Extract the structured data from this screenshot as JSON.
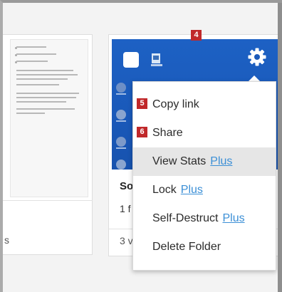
{
  "annotations": {
    "gear_badge": "4",
    "copy_link_badge": "5",
    "share_badge": "6"
  },
  "left_card": {
    "bottom_fragment": "s"
  },
  "right_card": {
    "title_fragment": "So",
    "subtitle_fragment": "1 f",
    "count_fragment": "3 v"
  },
  "menu": {
    "items": [
      {
        "label": "Copy link",
        "plus": ""
      },
      {
        "label": "Share",
        "plus": ""
      },
      {
        "label": "View Stats",
        "plus": "Plus"
      },
      {
        "label": "Lock",
        "plus": "Plus"
      },
      {
        "label": "Self-Destruct",
        "plus": "Plus"
      },
      {
        "label": "Delete Folder",
        "plus": ""
      }
    ],
    "hovered_index": 2
  },
  "colors": {
    "badge": "#c0282a",
    "plus_link": "#3b8fd6",
    "desktop_blue": "#1a59b9",
    "hover_bg": "#e6e6e6"
  },
  "icons": {
    "gear": "gear-icon"
  }
}
